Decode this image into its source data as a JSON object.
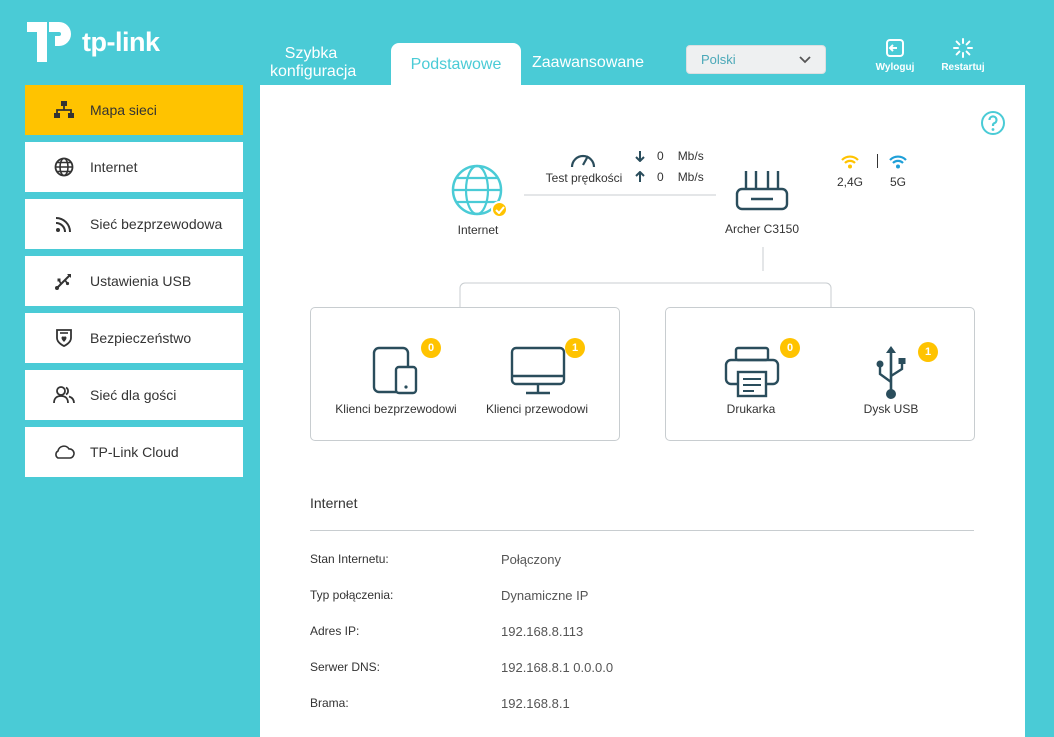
{
  "brand": {
    "logo_text": "tp-link",
    "accent": "#4acbd6",
    "highlight": "#ffc300"
  },
  "tabs": [
    {
      "label": "Szybka konfiguracja"
    },
    {
      "label": "Podstawowe"
    },
    {
      "label": "Zaawansowane"
    }
  ],
  "language": {
    "selected": "Polski"
  },
  "actions": {
    "logout": "Wyloguj",
    "restart": "Restartuj"
  },
  "sidebar": {
    "items": [
      {
        "label": "Mapa sieci",
        "icon": "network-map-icon"
      },
      {
        "label": "Internet",
        "icon": "globe-icon"
      },
      {
        "label": "Sieć bezprzewodowa",
        "icon": "wireless-icon"
      },
      {
        "label": "Ustawienia USB",
        "icon": "usb-icon"
      },
      {
        "label": "Bezpieczeństwo",
        "icon": "shield-icon"
      },
      {
        "label": "Sieć dla gości",
        "icon": "guests-icon"
      },
      {
        "label": "TP-Link Cloud",
        "icon": "cloud-icon"
      }
    ]
  },
  "map": {
    "internet_label": "Internet",
    "speed_test_label": "Test prędkości",
    "download": {
      "value": "0",
      "unit": "Mb/s"
    },
    "upload": {
      "value": "0",
      "unit": "Mb/s"
    },
    "router_label": "Archer C3150",
    "band_24": "2,4G",
    "band_5": "5G",
    "wireless_clients": {
      "label": "Klienci bezprzewodowi",
      "count": "0"
    },
    "wired_clients": {
      "label": "Klienci przewodowi",
      "count": "1"
    },
    "printer": {
      "label": "Drukarka",
      "count": "0"
    },
    "usb_disk": {
      "label": "Dysk USB",
      "count": "1"
    }
  },
  "internet_info": {
    "title": "Internet",
    "rows": [
      {
        "key": "Stan Internetu:",
        "value": "Połączony"
      },
      {
        "key": "Typ połączenia:",
        "value": "Dynamiczne IP"
      },
      {
        "key": "Adres IP:",
        "value": "192.168.8.113"
      },
      {
        "key": "Serwer DNS:",
        "value": "192.168.8.1 0.0.0.0"
      },
      {
        "key": "Brama:",
        "value": "192.168.8.1"
      }
    ]
  }
}
